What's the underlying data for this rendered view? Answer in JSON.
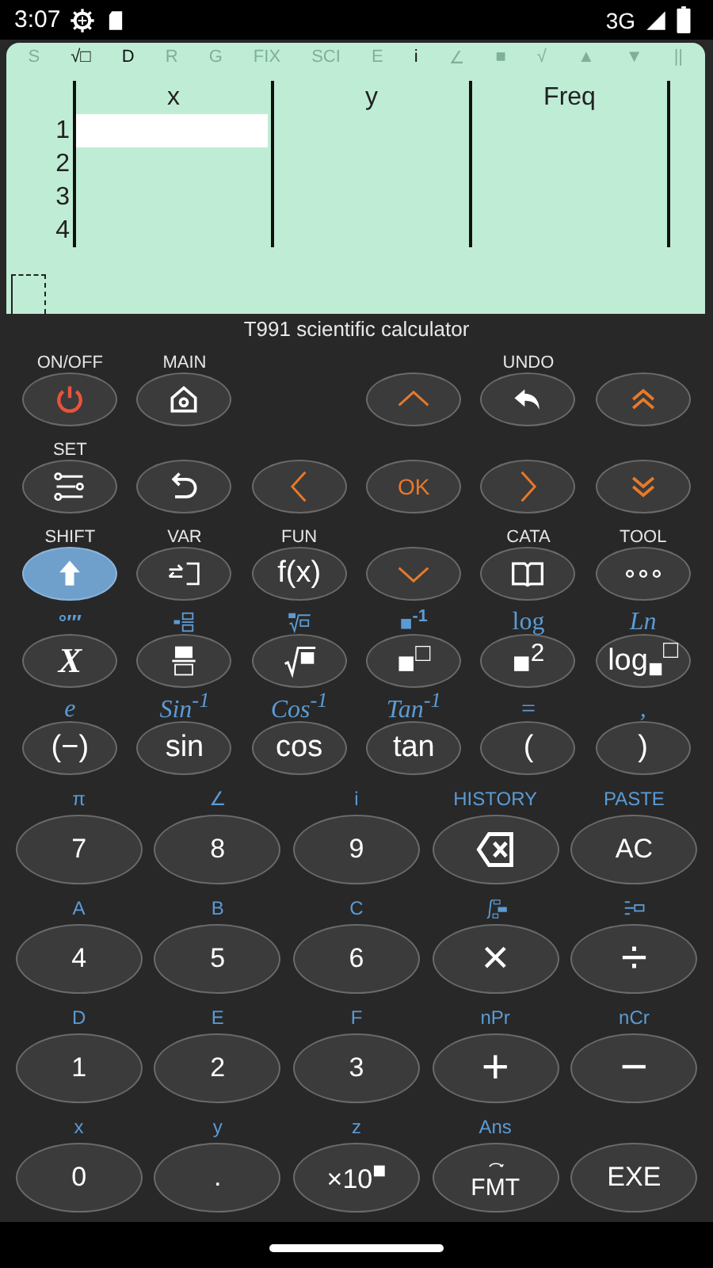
{
  "status_bar": {
    "time": "3:07",
    "network": "3G"
  },
  "display": {
    "indicators": [
      {
        "text": "S",
        "on": false
      },
      {
        "text": "√□",
        "on": true
      },
      {
        "text": "D",
        "on": true
      },
      {
        "text": "R",
        "on": false
      },
      {
        "text": "G",
        "on": false
      },
      {
        "text": "FIX",
        "on": false
      },
      {
        "text": "SCI",
        "on": false
      },
      {
        "text": "E",
        "on": false
      },
      {
        "text": "i",
        "on": true
      },
      {
        "text": "∠",
        "on": false
      },
      {
        "text": "■",
        "on": false
      },
      {
        "text": "√",
        "on": false
      },
      {
        "text": "▲",
        "on": false
      },
      {
        "text": "▼",
        "on": false
      },
      {
        "text": "||",
        "on": false
      }
    ],
    "table": {
      "columns": [
        "x",
        "y",
        "Freq"
      ],
      "rows": [
        {
          "number": "1",
          "selected": true
        },
        {
          "number": "2",
          "selected": false
        },
        {
          "number": "3",
          "selected": false
        },
        {
          "number": "4",
          "selected": false
        }
      ]
    }
  },
  "title": "T991 scientific calculator",
  "top_keys": [
    [
      {
        "above": "ON/OFF",
        "kind": "icon"
      },
      {
        "above": "MAIN",
        "kind": "icon"
      },
      {
        "kind": "blank"
      },
      {
        "kind": "icon"
      },
      {
        "above": "UNDO",
        "kind": "icon"
      },
      {
        "kind": "icon"
      }
    ],
    [
      {
        "above": "SET",
        "kind": "icon"
      },
      {
        "kind": "icon"
      },
      {
        "kind": "icon"
      },
      {
        "label": "OK",
        "kind": "accent"
      },
      {
        "kind": "icon"
      },
      {
        "kind": "icon"
      }
    ],
    [
      {
        "above": "SHIFT",
        "kind": "shift"
      },
      {
        "above": "VAR",
        "kind": "icon"
      },
      {
        "above": "FUN",
        "label": "f(x)",
        "kind": "text"
      },
      {
        "kind": "icon"
      },
      {
        "above": "CATA",
        "kind": "icon"
      },
      {
        "above": "TOOL",
        "kind": "icon"
      }
    ],
    [
      {
        "shift": "°′″",
        "label": "X",
        "kind": "math"
      },
      {
        "kind": "icon"
      },
      {
        "kind": "icon"
      },
      {
        "shift": "■$^{-1}$",
        "label": "■$^{□}$",
        "kind": "text"
      },
      {
        "shift": "log",
        "label": "■$^{2}$",
        "kind": "text"
      },
      {
        "shift": "Ln",
        "label": "log$_{■}$$^{□}$",
        "kind": "text"
      }
    ],
    [
      {
        "shift": "e",
        "label": "(−)",
        "kind": "text"
      },
      {
        "shift": "Sin$^{-1}$",
        "label": "sin",
        "kind": "text"
      },
      {
        "shift": "Cos$^{-1}$",
        "label": "cos",
        "kind": "text"
      },
      {
        "shift": "Tan$^{-1}$",
        "label": "tan",
        "kind": "text"
      },
      {
        "shift": "=",
        "label": "(",
        "kind": "text"
      },
      {
        "shift": ",",
        "label": ")",
        "kind": "text"
      }
    ]
  ],
  "number_keys": [
    [
      {
        "shift": "π",
        "label": "7",
        "kind": "text"
      },
      {
        "shift": "∠",
        "label": "8",
        "kind": "text"
      },
      {
        "shift": "i",
        "label": "9",
        "kind": "text"
      },
      {
        "shift": "HISTORY",
        "kind": "icon"
      },
      {
        "shift": "PASTE",
        "label": "AC",
        "kind": "text"
      }
    ],
    [
      {
        "shift": "A",
        "label": "4",
        "kind": "text"
      },
      {
        "shift": "B",
        "label": "5",
        "kind": "text"
      },
      {
        "shift": "C",
        "label": "6",
        "kind": "text"
      },
      {
        "label": "×",
        "kind": "symbol"
      },
      {
        "label": "÷",
        "kind": "symbol"
      }
    ],
    [
      {
        "shift": "D",
        "label": "1",
        "kind": "text"
      },
      {
        "shift": "E",
        "label": "2",
        "kind": "text"
      },
      {
        "shift": "F",
        "label": "3",
        "kind": "text"
      },
      {
        "shift": "nPr",
        "label": "+",
        "kind": "symbol"
      },
      {
        "shift": "nCr",
        "label": "−",
        "kind": "symbol"
      }
    ],
    [
      {
        "shift": "x",
        "label": "0",
        "kind": "text"
      },
      {
        "shift": "y",
        "label": ".",
        "kind": "text"
      },
      {
        "shift": "z",
        "label": "×10$^{■}$",
        "kind": "text"
      },
      {
        "shift": "Ans",
        "label": "FMT",
        "kind": "icon-text"
      },
      {
        "label": "EXE",
        "kind": "text"
      }
    ]
  ]
}
